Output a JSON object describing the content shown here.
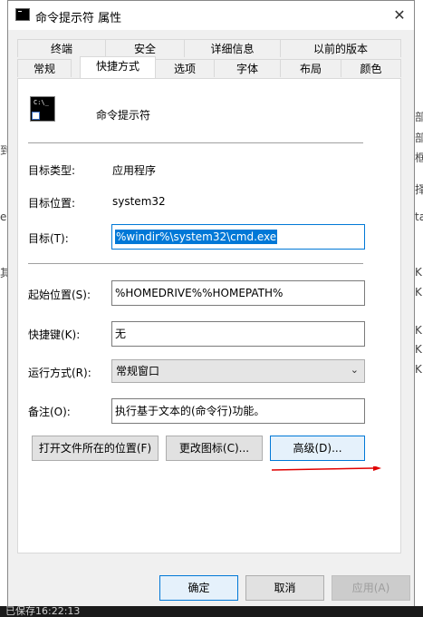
{
  "window": {
    "title": "命令提示符 属性",
    "close_glyph": "✕"
  },
  "tabs_row1": [
    "终端",
    "安全",
    "详细信息",
    "以前的版本"
  ],
  "tabs_row2": [
    "常规",
    "快捷方式",
    "选项",
    "字体",
    "布局",
    "颜色"
  ],
  "active_tab": "快捷方式",
  "shortcut": {
    "name": "命令提示符",
    "icon_text": "C:\\_",
    "target_type_label": "目标类型:",
    "target_type_value": "应用程序",
    "target_location_label": "目标位置:",
    "target_location_value": "system32",
    "target_label": "目标(T):",
    "target_value": "%windir%\\system32\\cmd.exe",
    "start_in_label": "起始位置(S):",
    "start_in_value": "%HOMEDRIVE%%HOMEPATH%",
    "hotkey_label": "快捷键(K):",
    "hotkey_value": "无",
    "run_label": "运行方式(R):",
    "run_value": "常规窗口",
    "comment_label": "备注(O):",
    "comment_value": "执行基于文本的(命令行)功能。",
    "open_location_button": "打开文件所在的位置(F)",
    "change_icon_button": "更改图标(C)...",
    "advanced_button": "高级(D)..."
  },
  "footer": {
    "ok": "确定",
    "cancel": "取消",
    "apply": "应用(A)"
  },
  "background": {
    "bottom_text": "已保存16:22:13",
    "right_chars": [
      "部",
      "部",
      "框",
      "择",
      "ta",
      "K",
      "K",
      "K",
      "K",
      "K"
    ],
    "left_chars": [
      "到",
      "en",
      "其"
    ]
  },
  "colors": {
    "accent": "#0078d7",
    "annotation_arrow": "#e00000"
  }
}
